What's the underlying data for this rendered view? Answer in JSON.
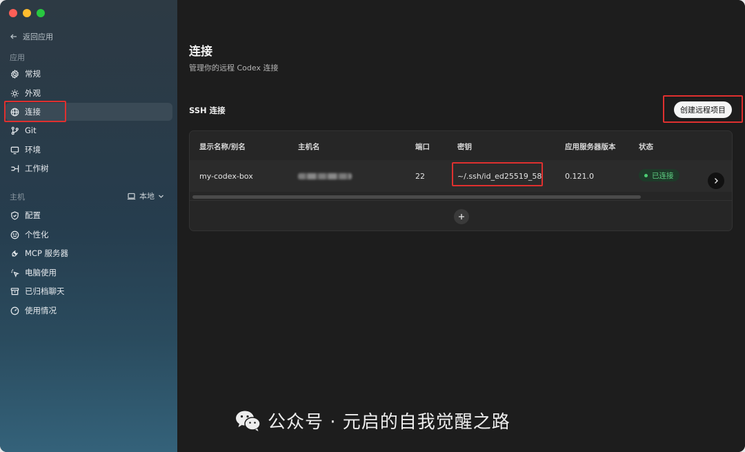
{
  "sidebar": {
    "back_label": "返回应用",
    "section_app": "应用",
    "items": [
      {
        "label": "常规",
        "icon": "gear-icon"
      },
      {
        "label": "外观",
        "icon": "sun-icon"
      },
      {
        "label": "连接",
        "icon": "globe-icon"
      },
      {
        "label": "Git",
        "icon": "git-branch-icon"
      },
      {
        "label": "环境",
        "icon": "monitor-icon"
      },
      {
        "label": "工作树",
        "icon": "tree-icon"
      }
    ],
    "section_host": "主机",
    "host_selector": "本地",
    "host_items": [
      {
        "label": "配置",
        "icon": "shield-icon"
      },
      {
        "label": "个性化",
        "icon": "smile-icon"
      },
      {
        "label": "MCP 服务器",
        "icon": "plug-icon"
      },
      {
        "label": "电脑使用",
        "icon": "cursor-icon"
      },
      {
        "label": "已归档聊天",
        "icon": "archive-icon"
      },
      {
        "label": "使用情况",
        "icon": "gauge-icon"
      }
    ]
  },
  "main": {
    "title": "连接",
    "subtitle": "管理你的远程 Codex 连接",
    "section_title": "SSH 连接",
    "create_button": "创建远程项目",
    "table": {
      "headers": [
        "显示名称/别名",
        "主机名",
        "端口",
        "密钥",
        "应用服务器版本",
        "状态"
      ],
      "rows": [
        {
          "name": "my-codex-box",
          "host": "",
          "port": "22",
          "key": "~/.ssh/id_ed25519_58",
          "version": "0.121.0",
          "status": "已连接"
        }
      ]
    }
  },
  "watermark": {
    "text": "公众号 · 元启的自我觉醒之路"
  },
  "colors": {
    "status_green": "#4ccd73",
    "highlight_red": "#e0302f"
  }
}
